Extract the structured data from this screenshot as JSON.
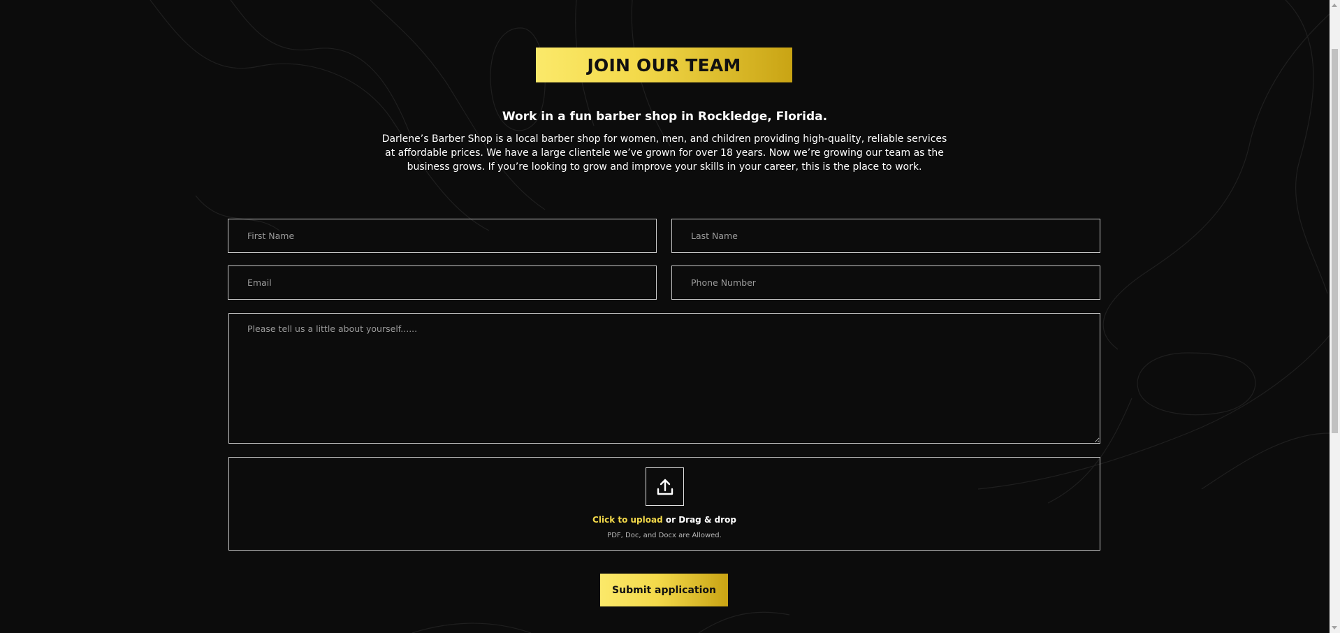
{
  "header": {
    "title": "JOIN OUR TEAM",
    "subtitle": "Work in a fun barber shop in Rockledge, Florida.",
    "intro": "Darlene’s Barber Shop is a local barber shop for women, men, and children providing high-quality, reliable services at affordable prices. We have a large clientele we’ve grown for over 18 years. Now we’re growing our team as the business grows. If you’re looking to grow and improve your skills in your career, this is the place to work."
  },
  "form": {
    "first_name_placeholder": "First Name",
    "last_name_placeholder": "Last Name",
    "email_placeholder": "Email",
    "phone_placeholder": "Phone Number",
    "about_placeholder": "Please tell us a little about yourself......",
    "upload": {
      "icon": "upload-icon",
      "link_text": "Click to upload",
      "rest_text": " or Drag & drop",
      "hint": "PDF, Doc, and Docx are Allowed."
    },
    "submit_label": "Submit application"
  },
  "colors": {
    "background": "#0c0c0c",
    "accent_gold": "#f3d94a",
    "accent_gold_dark": "#c9a414",
    "border": "#c8c8c8"
  }
}
